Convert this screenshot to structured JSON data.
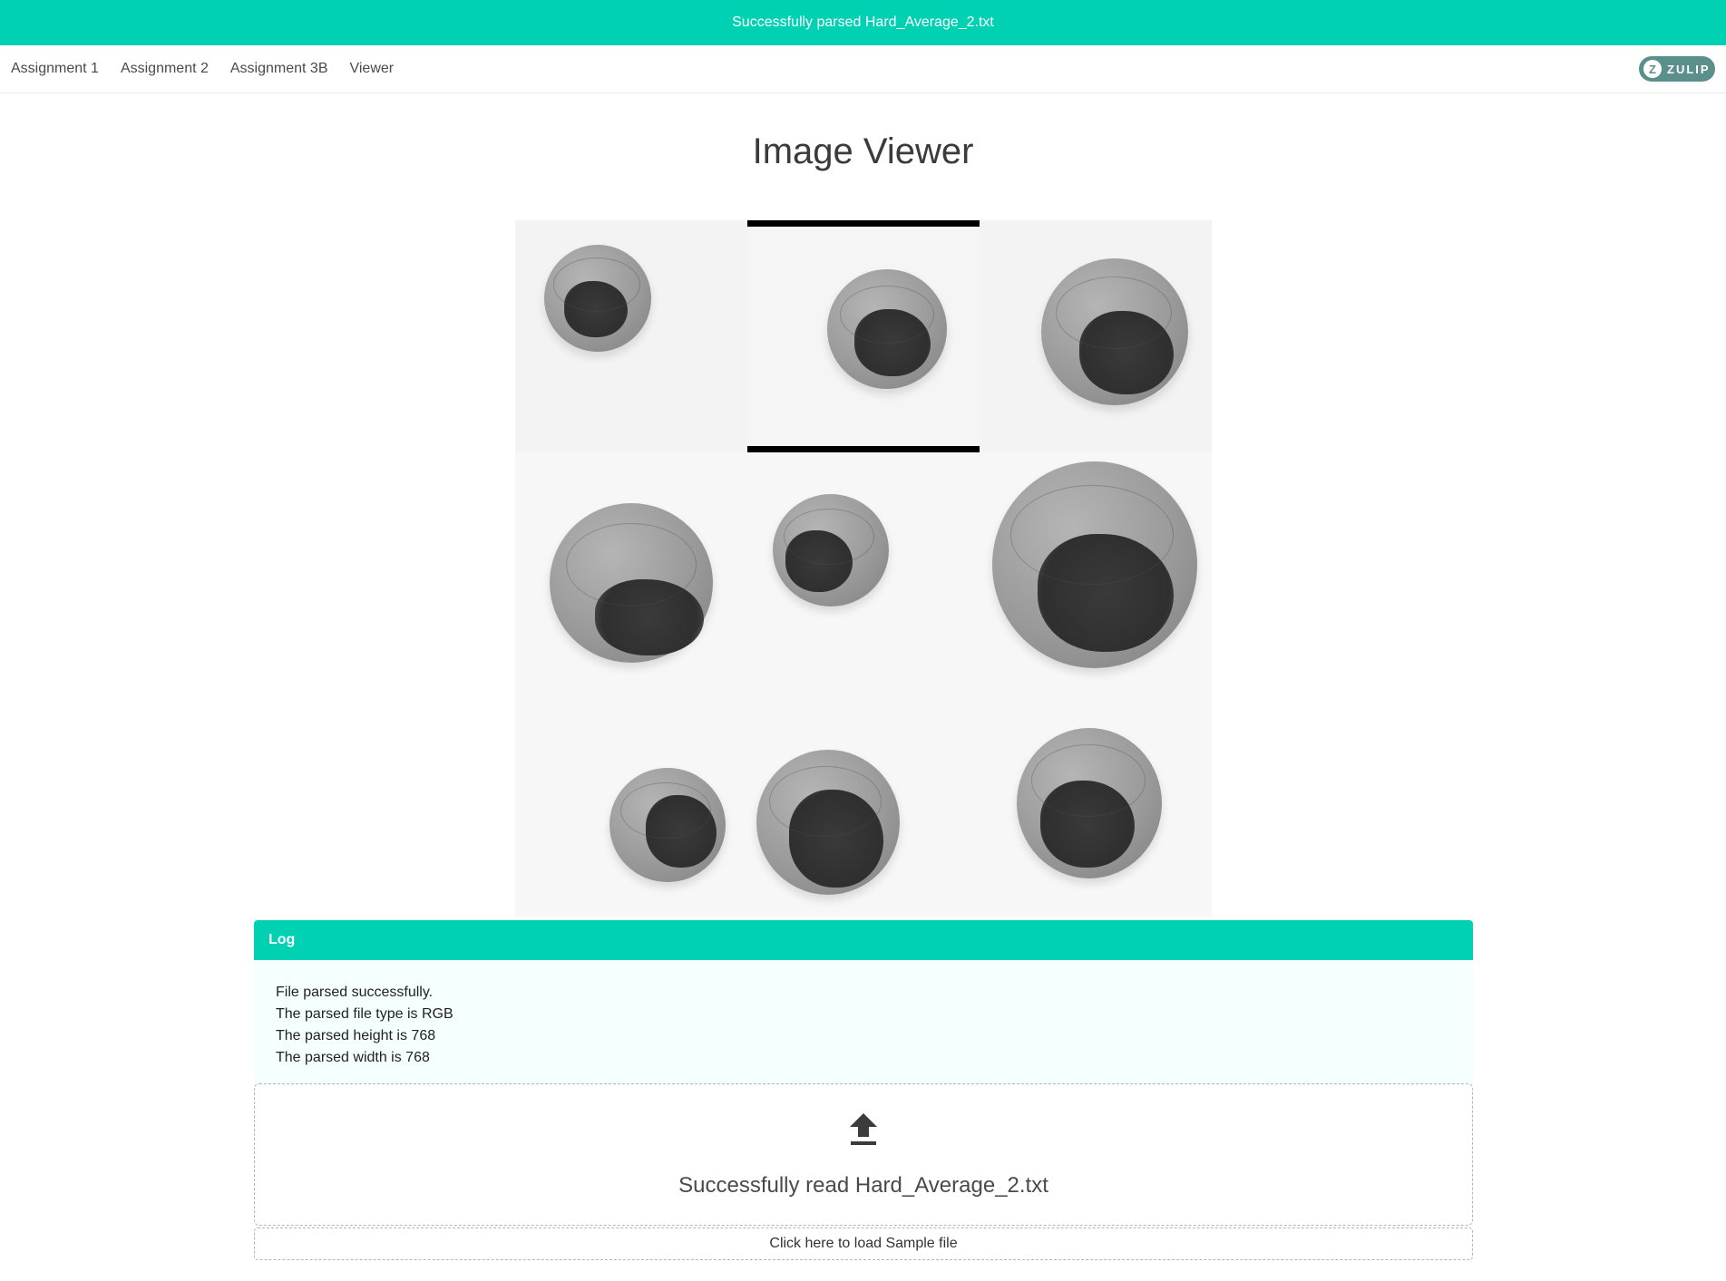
{
  "toast": {
    "message": "Successfully parsed Hard_Average_2.txt"
  },
  "nav": {
    "items": [
      {
        "label": "Assignment 1"
      },
      {
        "label": "Assignment 2"
      },
      {
        "label": "Assignment 3B"
      },
      {
        "label": "Viewer"
      }
    ],
    "badge": {
      "letter": "Z",
      "label": "ZULIP"
    }
  },
  "page": {
    "title": "Image Viewer"
  },
  "images": {
    "count": 9,
    "selected_index": 1
  },
  "log": {
    "header": "Log",
    "lines": [
      "File parsed successfully.",
      "The parsed file type is RGB",
      "The parsed height is 768",
      "The parsed width is 768"
    ]
  },
  "upload": {
    "icon": "upload-icon",
    "status": "Successfully read Hard_Average_2.txt",
    "sample_link": "Click here to load Sample file"
  },
  "colors": {
    "accent": "#00d1b2",
    "badge": "#5b8f8c",
    "log_bg": "#f5fffd"
  }
}
